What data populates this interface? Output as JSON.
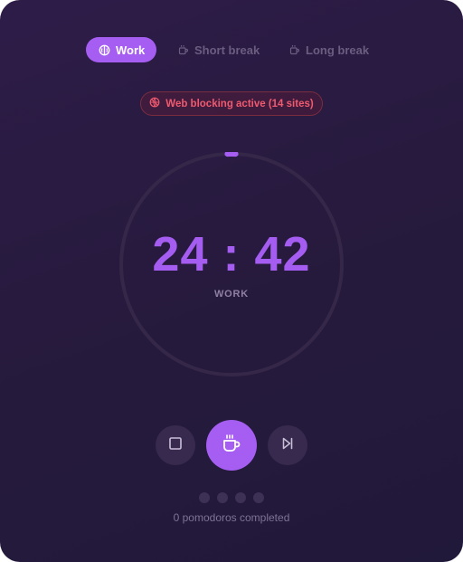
{
  "tabs": {
    "work": {
      "label": "Work",
      "icon": "brain-icon",
      "active": true
    },
    "short_break": {
      "label": "Short break",
      "icon": "coffee-icon",
      "active": false
    },
    "long_break": {
      "label": "Long break",
      "icon": "coffee-icon",
      "active": false
    }
  },
  "blocking": {
    "label": "Web blocking active (14 sites)",
    "icon": "globe-blocked-icon"
  },
  "timer": {
    "minutes": "24",
    "separator": ":",
    "seconds": "42",
    "mode_label": "WORK",
    "progress_fraction": 0.012
  },
  "controls": {
    "stop_icon": "stop-icon",
    "main_icon": "coffee-cup-icon",
    "skip_icon": "skip-next-icon"
  },
  "pomodoros": {
    "dots_total": 4,
    "dots_filled": 0,
    "completed_text": "0 pomodoros completed"
  },
  "colors": {
    "accent": "#a65ef2",
    "timer_text": "#a45df0",
    "blocking_text": "#ef5a6f",
    "background": "#2a1c42"
  }
}
